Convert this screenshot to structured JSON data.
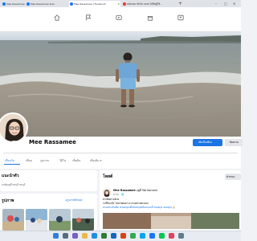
{
  "browser": {
    "tabs": [
      {
        "label": "Mee Rassamee",
        "favicon_color": "#1877f2"
      },
      {
        "label": "Mee Rassamee Suki",
        "favicon_color": "#1877f2"
      },
      {
        "label": "Mee Rassamee | Facebook",
        "favicon_color": "#1877f2",
        "active": true
      },
      {
        "label": "สมัครสมาชิกรับ SMS ใส่ชื่อผู้ใช้...",
        "favicon_color": "#e53935"
      }
    ],
    "new_tab": "+",
    "window_controls": [
      "–",
      "▢",
      "✕"
    ]
  },
  "nav": {
    "icons": [
      "home-icon",
      "flag-icon",
      "video-icon",
      "marketplace-icon",
      "groups-icon"
    ],
    "active_index": 4
  },
  "profile": {
    "name": "Mee Rassamee",
    "edit_button": "เพิ่มเป็นเพื่อน",
    "more_button": "ข้อความ",
    "tabs": [
      "เกี่ยวกับ",
      "เพื่อน",
      "รูปภาพ",
      "วิดีโอ",
      "เช็คอิน",
      "เพิ่มเติม ▾"
    ],
    "active_tab": 0
  },
  "intro": {
    "title": "แนะนำตัว",
    "detail": "อาศัยอยู่ที่ ชลบุรี ชลบุรี"
  },
  "photos": {
    "title": "รูปภาพ",
    "see_all": "ดูรูปภาพทั้งหมด"
  },
  "posts": {
    "title": "โพสต์",
    "filter_button": "ตัวกรอง",
    "author": "Mee Rassamee",
    "author_suffix": "อยู่ที่ Tak Kornorn",
    "time": "8 ชม. · 🌐",
    "lines": [
      "ฝากติดตามด้วย",
      "กะปิ๊ก๊อะกุ๊ม ไม่หาพลอยๆ มากแค่ตามพะยอม",
      "#รอยกะลัมเด็ด #ขอบคุณที่สนับสนุนพร้อมแบบนี้ ขอบคุณ ขอบคุณ 🙏"
    ]
  },
  "colors": {
    "accent": "#1b74e4",
    "page_bg": "#f0f2f5"
  }
}
